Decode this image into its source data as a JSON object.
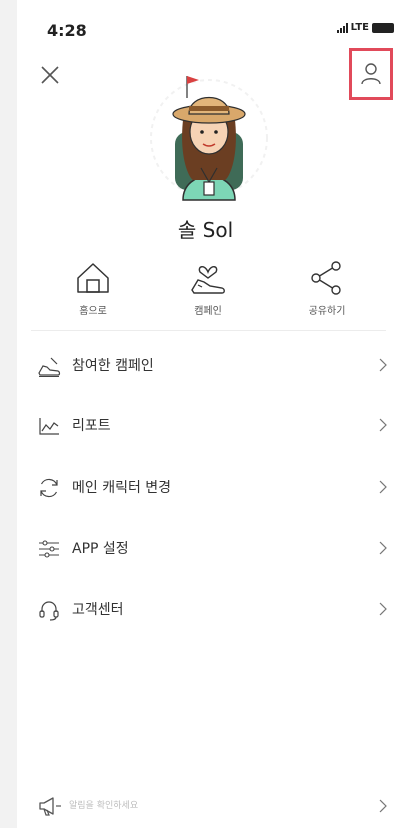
{
  "status_bar": {
    "time": "4:28",
    "network": "LTE"
  },
  "user": {
    "name": "솔 Sol"
  },
  "quick_actions": [
    {
      "label": "홈으로",
      "icon": "home-icon"
    },
    {
      "label": "캠페인",
      "icon": "shoe-heart-icon"
    },
    {
      "label": "공유하기",
      "icon": "share-icon"
    }
  ],
  "menu": [
    {
      "label": "참여한 캠페인",
      "icon": "shoe-icon"
    },
    {
      "label": "리포트",
      "icon": "chart-line-icon"
    },
    {
      "label": "메인 캐릭터 변경",
      "icon": "refresh-icon"
    },
    {
      "label": "APP 설정",
      "icon": "sliders-icon"
    },
    {
      "label": "고객센터",
      "icon": "headset-icon"
    }
  ],
  "notice": {
    "text": "알림을 확인하세요",
    "icon": "megaphone-icon"
  },
  "colors": {
    "highlight": "#e14a5a",
    "avatar_shirt": "#7dd6b6",
    "hat": "#d9a86b"
  }
}
